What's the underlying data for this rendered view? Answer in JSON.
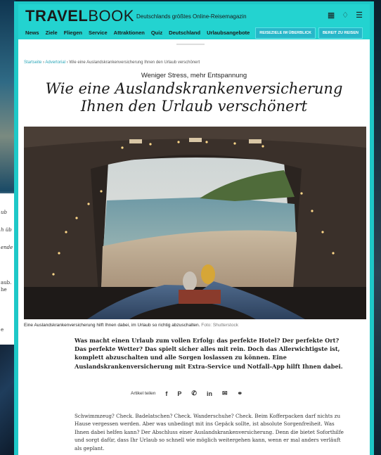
{
  "background": {
    "left_fragments": [
      "ub",
      "h üb",
      "ende",
      "aub.",
      "he",
      "e"
    ]
  },
  "header": {
    "logo_bold": "TRAVEL",
    "logo_thin": "BOOK",
    "tagline": "Deutschlands größtes Online-Reisemagazin",
    "icons": [
      "grid-icon",
      "bell-icon",
      "menu-icon"
    ],
    "nav": [
      "News",
      "Ziele",
      "Fliegen",
      "Service",
      "Attraktionen",
      "Quiz",
      "Deutschland",
      "Urlaubsangebote"
    ],
    "button_1": "REISEZIELE IM ÜBERBLICK",
    "button_2": "BEREIT ZU REISEN",
    "accent_color": "#23d3d0"
  },
  "article": {
    "breadcrumb_home": "Startseite",
    "breadcrumb_section": "Advertorial",
    "breadcrumb_current": "Wie eine Auslandskrankenversicherung Ihnen den Urlaub verschönert",
    "kicker": "Weniger Stress, mehr Entspannung",
    "headline": "Wie eine Auslandskrankenversicherung Ihnen den Urlaub verschönert",
    "caption": "Eine Auslandskrankenversicherung hilft Ihnen dabei, im Urlaub so richtig abzuschalten.",
    "caption_source": "Foto: Shutterstock",
    "lead": "Was macht einen Urlaub zum vollen Erfolg: das perfekte Hotel? Der perfekte Ort? Das perfekte Wetter? Das spielt sicher alles mit rein. Doch das Allerwichtigste ist, komplett abzuschalten und alle Sorgen loslassen zu können. Eine Auslandskrankenversicherung mit Extra-Service und Notfall-App hilft Ihnen dabei.",
    "share_label": "Artikel teilen",
    "share_icons": [
      "f",
      "P",
      "✆",
      "in",
      "✉",
      "⚭"
    ],
    "body": "Schwimmzeug? Check. Badelatschen? Check. Wanderschuhe? Check. Beim Kofferpacken darf nichts zu Hause vergessen werden. Aber was unbedingt mit ins Gepäck sollte, ist absolute Sorgenfreiheit. Was Ihnen dabei helfen kann? Der Abschluss einer Auslandskrankenversicherung. Denn die bietet Soforthilfe und sorgt dafür, dass Ihr Urlaub so schnell wie möglich weitergehen kann, wenn er mal anders verläuft als geplant."
  }
}
